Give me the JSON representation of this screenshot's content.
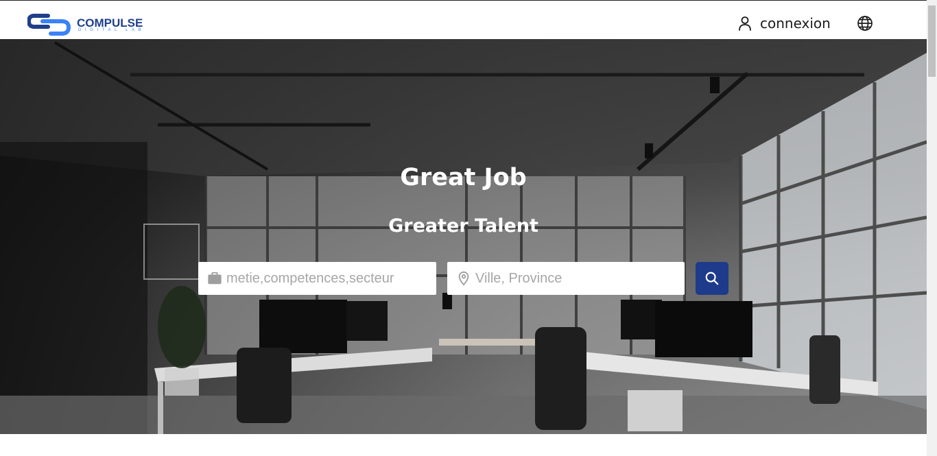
{
  "header": {
    "logo_text": "COMPULSE",
    "logo_subtext": "DIGITAL LAB",
    "login_label": "connexion"
  },
  "hero": {
    "title": "Great Job",
    "subtitle": "Greater Talent"
  },
  "search": {
    "job_placeholder": "metie,competences,secteur",
    "job_value": "",
    "location_placeholder": "Ville, Province",
    "location_value": ""
  },
  "colors": {
    "brand_navy": "#1f3f8a",
    "brand_blue": "#3b82f6",
    "search_button": "#1e3a8a"
  },
  "icons": {
    "login": "user-icon",
    "language": "globe-icon",
    "job_field": "briefcase-icon",
    "location_field": "map-pin-icon",
    "search_button": "search-icon"
  }
}
